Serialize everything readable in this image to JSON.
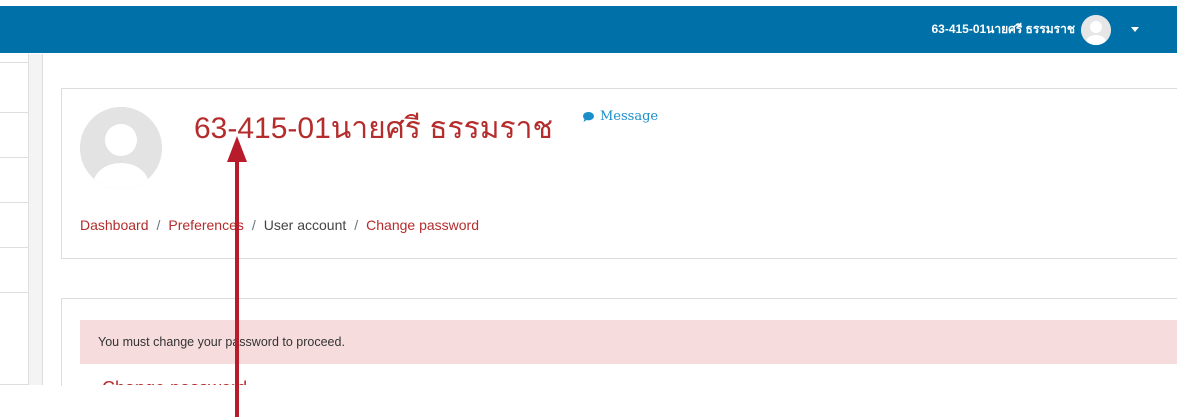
{
  "navbar": {
    "user_name": "63-415-01นายศรี ธรรมราช",
    "avatar_icon": "user-avatar-icon",
    "menu_icon": "caret-down-icon",
    "bg_color": "#0070a8"
  },
  "profile": {
    "name": "63-415-01นายศรี ธรรมราช",
    "message_label": "Message",
    "message_icon": "speech-bubble-icon",
    "name_color": "#b42c2c",
    "link_color": "#1a8ec9"
  },
  "breadcrumb": {
    "items": [
      {
        "label": "Dashboard",
        "link": true
      },
      {
        "label": "Preferences",
        "link": true
      },
      {
        "label": "User account",
        "link": false
      },
      {
        "label": "Change password",
        "link": true
      }
    ],
    "separator": "/"
  },
  "alert": {
    "text": "You must change your password to proceed.",
    "bg_color": "#f7dcde"
  },
  "content": {
    "heading": "Change password"
  },
  "annotation": {
    "arrow_color": "#b81c2a",
    "arrow_icon": "arrow-up-icon"
  }
}
